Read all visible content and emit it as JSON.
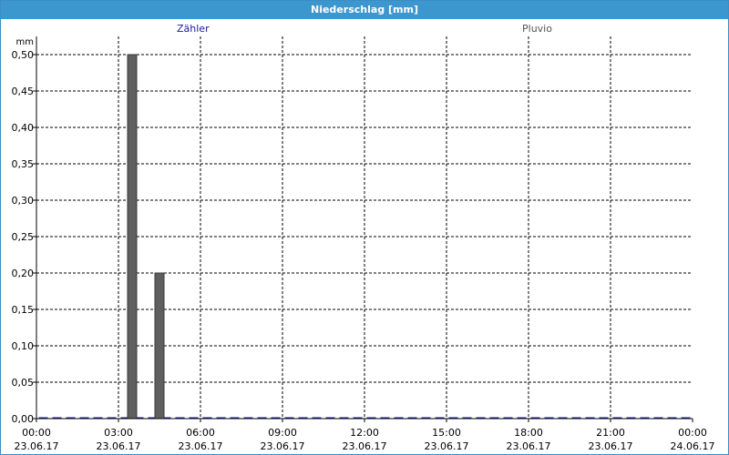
{
  "window": {
    "title": "Niederschlag [mm]"
  },
  "legend": [
    {
      "name": "Zähler",
      "color": "#1a1aa6"
    },
    {
      "name": "Pluvio",
      "color": "#555555"
    }
  ],
  "colors": {
    "title_bar": "#3c97cf",
    "bar": "#5f5f5f",
    "axis": "#000000",
    "grid": "#000000"
  },
  "chart_data": {
    "type": "bar",
    "title": "Niederschlag [mm]",
    "ylabel": "mm",
    "xlabel": "",
    "ylim": [
      0,
      0.5
    ],
    "y_ticks": [
      "0,00",
      "0,05",
      "0,10",
      "0,15",
      "0,20",
      "0,25",
      "0,30",
      "0,35",
      "0,40",
      "0,45",
      "0,50"
    ],
    "x_ticks": [
      {
        "time": "00:00",
        "date": "23.06.17"
      },
      {
        "time": "03:00",
        "date": "23.06.17"
      },
      {
        "time": "06:00",
        "date": "23.06.17"
      },
      {
        "time": "09:00",
        "date": "23.06.17"
      },
      {
        "time": "12:00",
        "date": "23.06.17"
      },
      {
        "time": "15:00",
        "date": "23.06.17"
      },
      {
        "time": "18:00",
        "date": "23.06.17"
      },
      {
        "time": "21:00",
        "date": "23.06.17"
      },
      {
        "time": "00:00",
        "date": "24.06.17"
      }
    ],
    "grid": true,
    "series": [
      {
        "name": "Pluvio",
        "x": [
          "23.06.17 03:30",
          "23.06.17 04:30"
        ],
        "values": [
          0.5,
          0.2
        ]
      }
    ]
  }
}
